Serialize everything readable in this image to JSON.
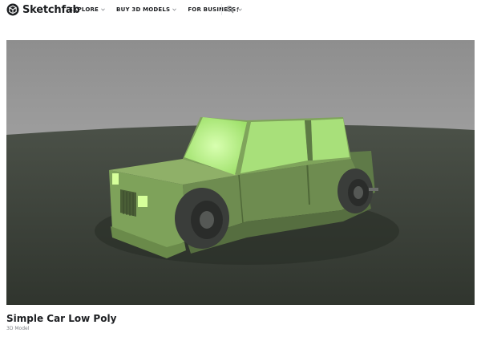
{
  "app": {
    "brand": "Sketchfab",
    "logo_icon": "sketchfab-cube-icon"
  },
  "nav": {
    "items": [
      {
        "label": "EXPLORE",
        "icon": "chevron-down-icon"
      },
      {
        "label": "BUY 3D MODELS",
        "icon": "chevron-down-icon"
      },
      {
        "label": "FOR BUSINESS",
        "icon": "chevron-down-icon"
      }
    ]
  },
  "search": {
    "value": "f",
    "icon": "search-icon"
  },
  "viewer": {
    "model_colors": {
      "body": "#8fbd63",
      "window_glow": "#b8f58a",
      "tire": "#3a3d3a",
      "sky_top": "#8e8e8e",
      "ground": "#3c4239"
    }
  },
  "model": {
    "title": "Simple Car Low Poly",
    "subtitle": "3D Model"
  }
}
